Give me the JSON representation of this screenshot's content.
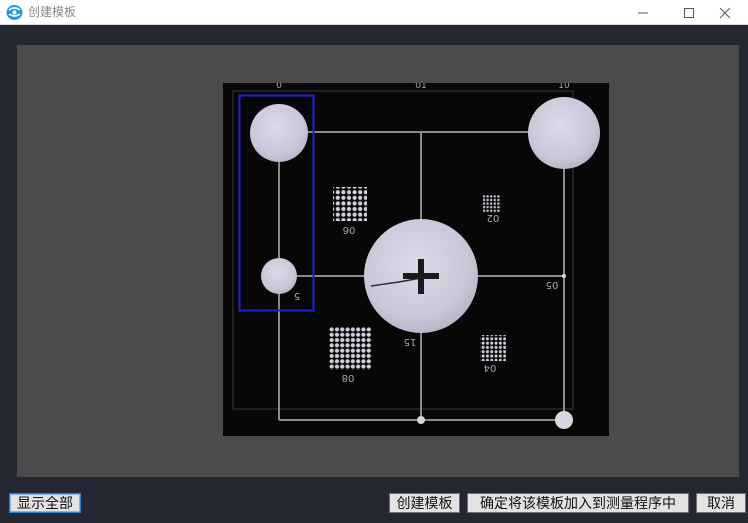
{
  "window": {
    "title": "创建模板",
    "icon": "app-logo-icon",
    "controls": [
      "minimize-icon",
      "maximize-icon",
      "close-icon"
    ]
  },
  "image": {
    "labels": {
      "top_left": "0",
      "top_mid": "01",
      "top_right": "10",
      "grid_06": "06",
      "grid_02": "02",
      "circle_5": "5",
      "mark_05": "05",
      "center_15": "15",
      "grid_08": "08",
      "grid_04": "04"
    }
  },
  "buttons": {
    "show_all": "显示全部",
    "create_template": "创建模板",
    "confirm_add": "确定将该模板加入到测量程序中",
    "cancel": "取消"
  },
  "colors": {
    "accent_blue": "#1f22d8",
    "background": "#232833",
    "workarea": "#4b4b4b"
  }
}
